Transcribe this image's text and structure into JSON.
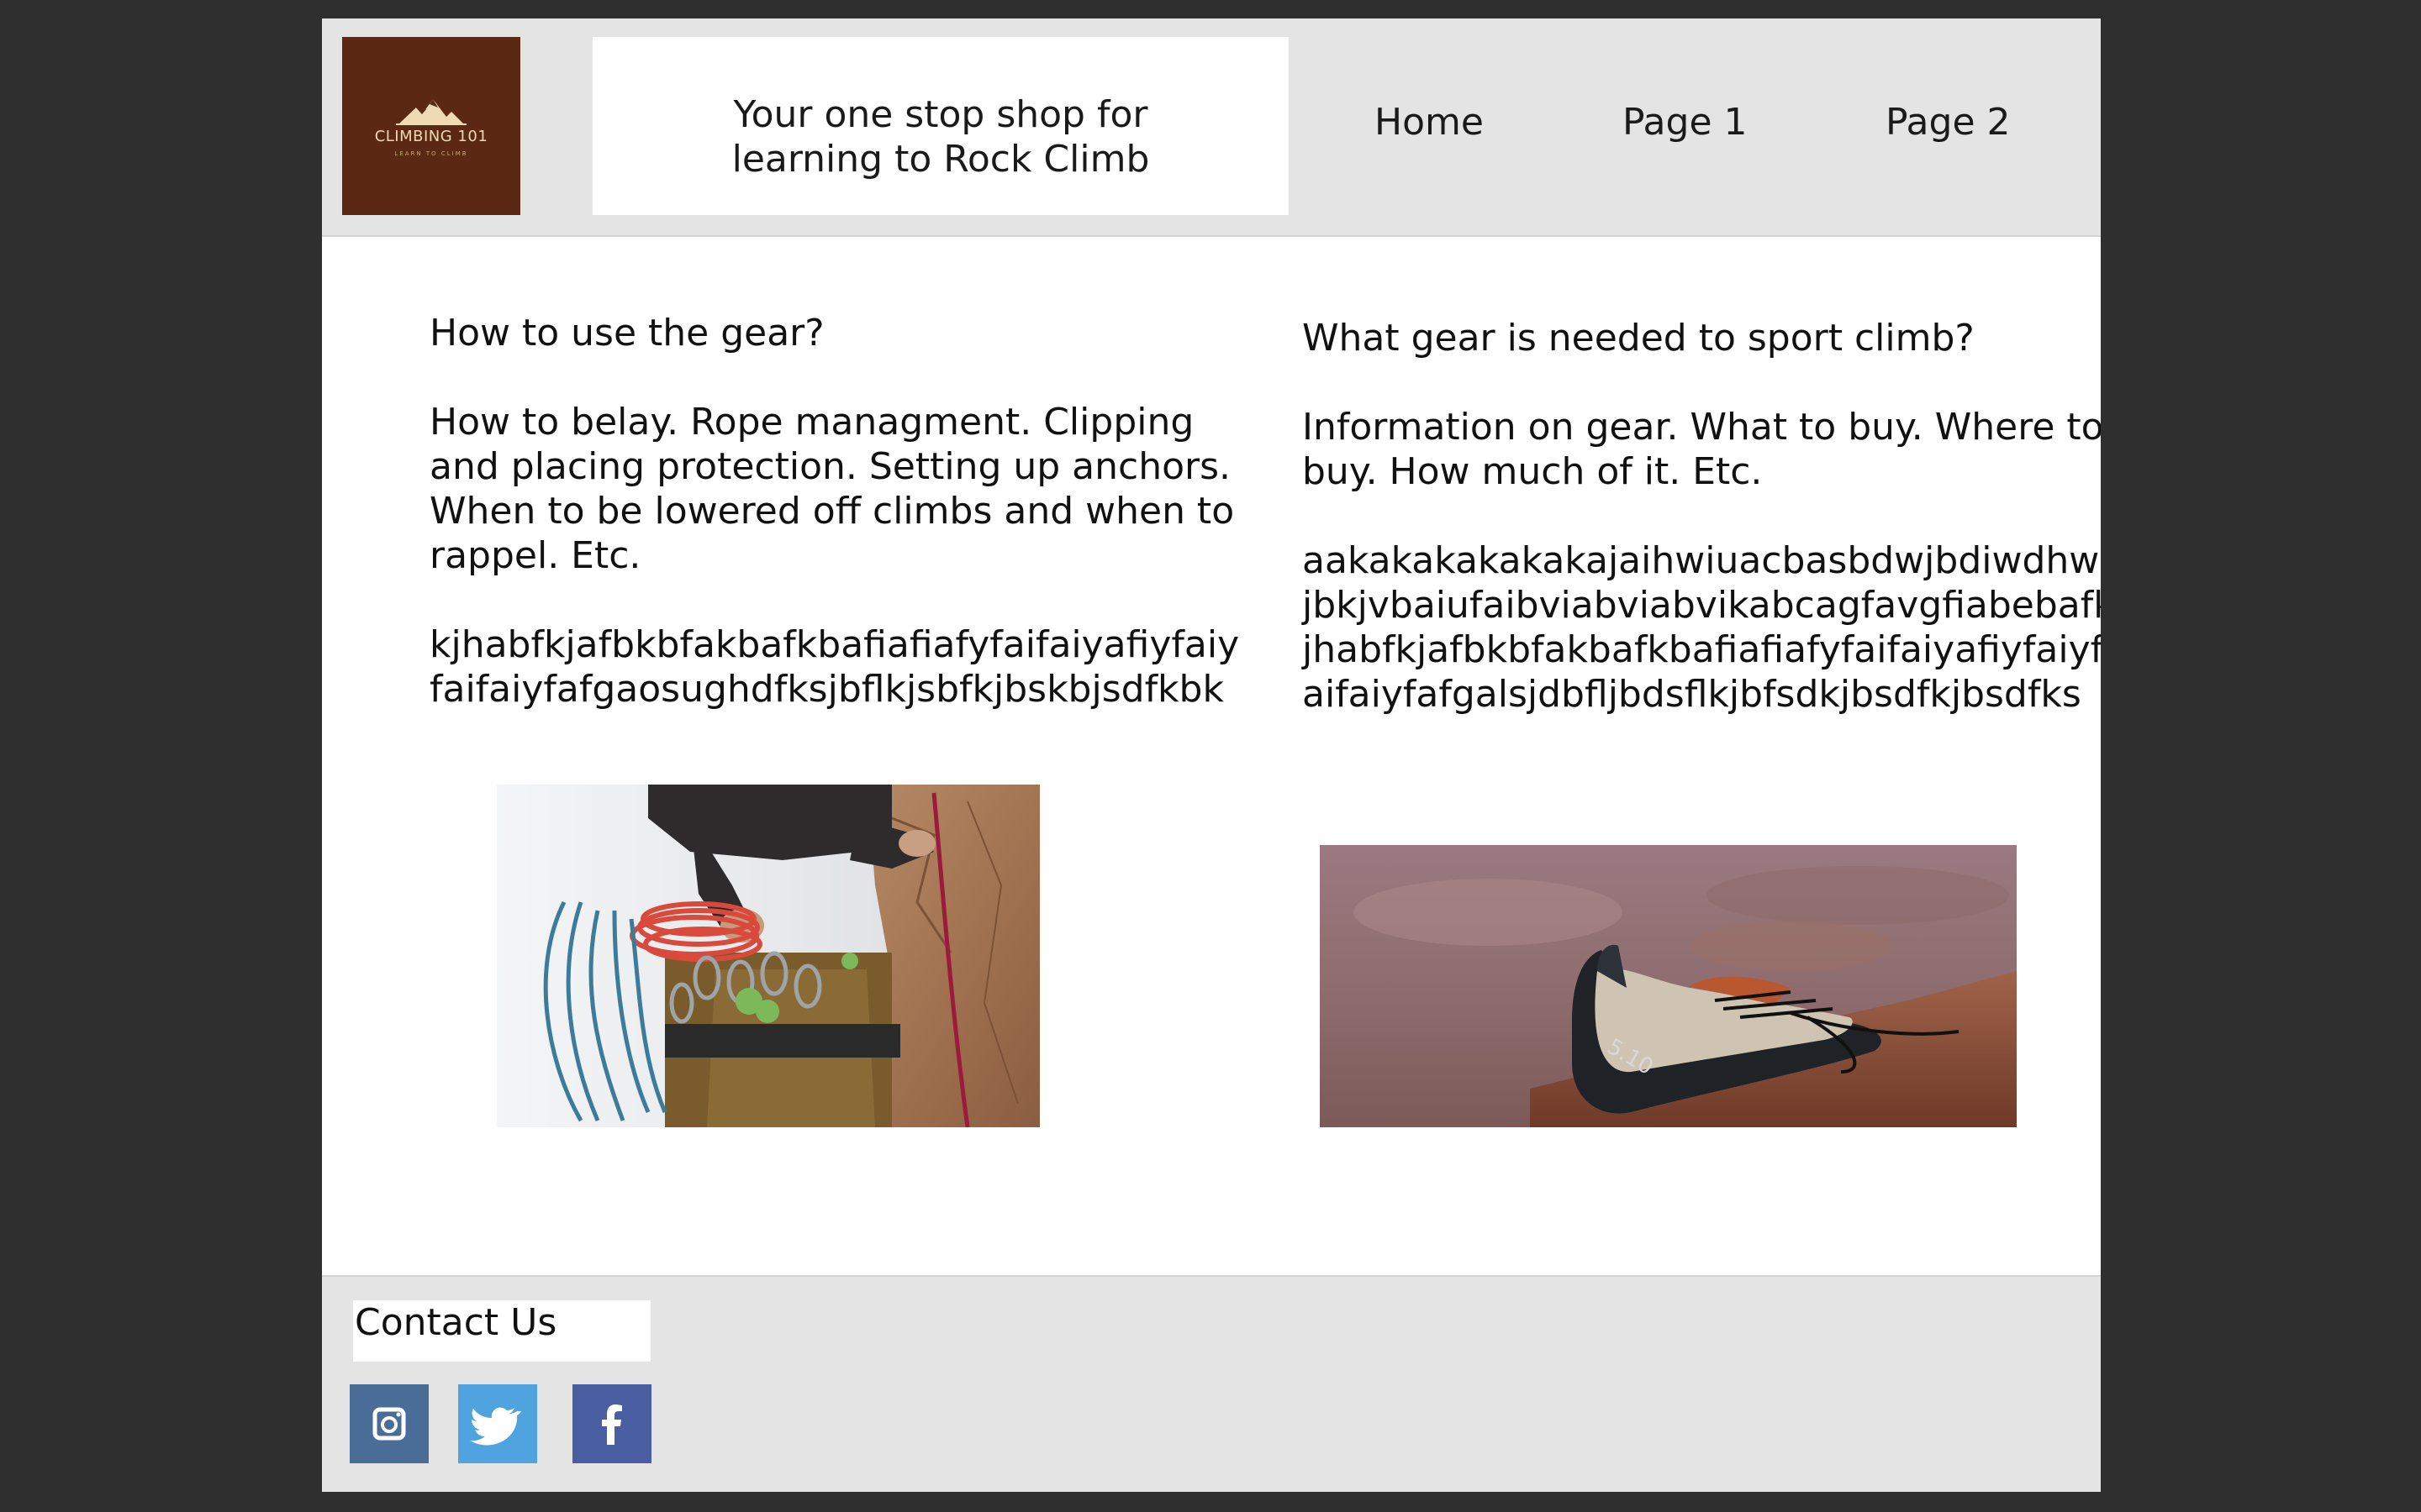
{
  "header": {
    "logo": {
      "title": "CLIMBING 101",
      "subtitle": "LEARN TO CLIMB",
      "icon": "mountain-icon",
      "background_color": "#5b2813"
    },
    "tagline_line1": "Your one stop shop for",
    "tagline_line2": "learning to Rock Climb",
    "nav": {
      "home": "Home",
      "page1": "Page 1",
      "page2": "Page 2"
    }
  },
  "left_column": {
    "heading": "How to use the gear?",
    "body_lines": [
      "How to belay. Rope managment. Clipping",
      "and placing protection. Setting up anchors.",
      "When to be lowered off climbs and when to",
      "rappel. Etc."
    ],
    "filler_lines": [
      "kjhabfkjafbkbfakbafkbafiafiafyfaifaiyafiyfaiy",
      "faifaiyfafgaosughdfksjbflkjsbfkjbskbjsdfkbk"
    ],
    "image": "climber-gear-harness-photo"
  },
  "right_column": {
    "heading": "What gear is needed to sport climb?",
    "body_lines": [
      "Information on gear. What to buy. Where to",
      "buy. How much of it. Etc."
    ],
    "filler_lines": [
      "aakakakakakakajaihwiuacbasbdwjbdiwdhwbk",
      "jbkjvbaiufaibviabviabvikabcagfavgfiabebafk",
      "jhabfkjafbkbfakbafkbafiafiafyfaifaiyafiyfaiyf",
      "aifaiyfafgalsjdbfljbdsflkjbfsdkjbsdfkjbsdfks"
    ],
    "image": "climbing-shoe-photo",
    "shoe_marking": "5.10"
  },
  "footer": {
    "contact_label": "Contact Us",
    "social": [
      {
        "name": "instagram-icon",
        "color": "#4a6d98"
      },
      {
        "name": "twitter-icon",
        "color": "#4fa3de"
      },
      {
        "name": "facebook-icon",
        "color": "#4a5ea2"
      }
    ]
  },
  "colors": {
    "page_background": "#2f2f2f",
    "header_footer_background": "#e4e4e4",
    "content_background": "#ffffff"
  }
}
